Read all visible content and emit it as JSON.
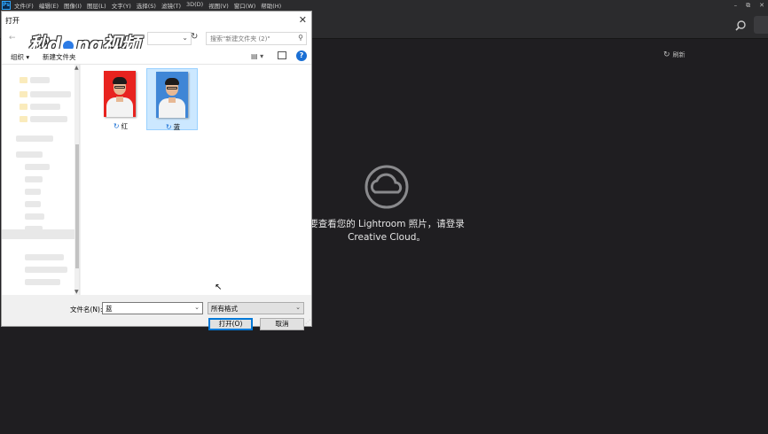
{
  "ps": {
    "logo": "Ps",
    "menu": [
      "文件(F)",
      "编辑(E)",
      "图像(I)",
      "图层(L)",
      "文字(Y)",
      "选择(S)",
      "滤镜(T)",
      "3D(D)",
      "视图(V)",
      "窗口(W)",
      "帮助(H)"
    ],
    "window_controls": {
      "minimize": "–",
      "restore": "⧉",
      "close": "✕"
    }
  },
  "lightroom": {
    "refresh_label": "刷新",
    "message_line1": "要查看您的 Lightroom 照片，请登录",
    "message_line2": "Creative Cloud。"
  },
  "dialog": {
    "title": "打开",
    "close": "✕",
    "watermark_a": "秒",
    "watermark_b": "d",
    "watermark_c": "ng视频",
    "search_placeholder": "搜索\"新建文件夹 (2)\"",
    "organize": "组织 ▾",
    "new_folder": "新建文件夹",
    "files": [
      {
        "name": "红",
        "bg": "#e8231f",
        "selected": false
      },
      {
        "name": "蓝",
        "bg": "#3f86d6",
        "selected": true
      }
    ],
    "filename_label": "文件名(N):",
    "filename_value": "蓝",
    "filetype_value": "所有格式",
    "open_button": "打开(O)",
    "cancel_button": "取消"
  },
  "colors": {
    "accent": "#0078d7",
    "ps_bg": "#1f1e21",
    "red_bg": "#e8231f",
    "blue_bg": "#3f86d6"
  }
}
